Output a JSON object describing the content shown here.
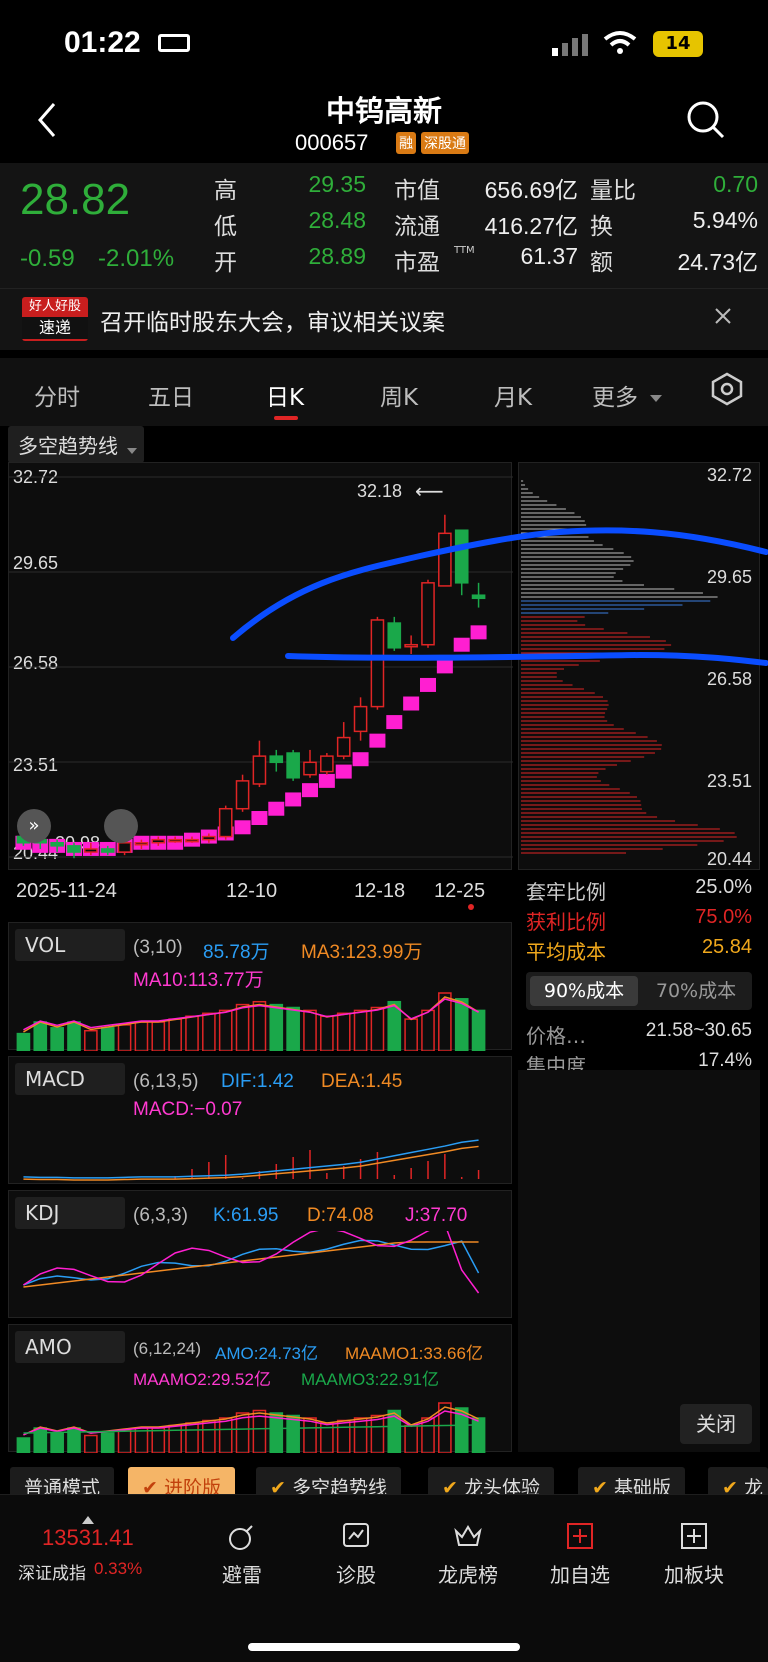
{
  "status": {
    "time": "01:22",
    "battery": "14"
  },
  "header": {
    "title": "中钨高新",
    "code": "000657",
    "badge_rong": "融",
    "badge_sgt": "深股通"
  },
  "quote": {
    "price": "28.82",
    "change": "-0.59",
    "change_pct": "-2.01%",
    "high_label": "高",
    "high": "29.35",
    "low_label": "低",
    "low": "28.48",
    "open_label": "开",
    "open": "28.89",
    "mcap_label": "市值",
    "mcap": "656.69亿",
    "float_label": "流通",
    "float": "416.27亿",
    "pe_label": "市盈",
    "pe_sup": "TTM",
    "pe": "61.37",
    "vr_label": "量比",
    "vr": "0.70",
    "turn_label": "换",
    "turn": "5.94%",
    "amt_label": "额",
    "amt": "24.73亿"
  },
  "news": {
    "logo_top": "好人好股",
    "logo_bottom": "速递",
    "text": "召开临时股东大会，审议相关议案"
  },
  "tabs": [
    "分时",
    "五日",
    "日K",
    "周K",
    "月K",
    "更多"
  ],
  "kline": {
    "indicator": "多空趋势线",
    "y_ticks": [
      "32.72",
      "29.65",
      "26.58",
      "23.51",
      "20.44"
    ],
    "max_label": "32.18",
    "min_label": "20.98",
    "x_ticks": [
      "2025-11-24",
      "12-10",
      "12-18",
      "12-25"
    ]
  },
  "right_panel": {
    "trapped_label": "套牢比例",
    "trapped": "25.0%",
    "profit_label": "获利比例",
    "profit": "75.0%",
    "avg_label": "平均成本",
    "avg": "25.84",
    "tab90": "90%成本",
    "tab70": "70%成本",
    "range_label": "价格…",
    "range": "21.58~30.65",
    "conc_label": "集中度",
    "conc": "17.4%",
    "close": "关闭"
  },
  "vol": {
    "name": "VOL",
    "params": "(3,10)",
    "v": "85.78万",
    "ma3": "MA3:123.99万",
    "ma10": "MA10:113.77万"
  },
  "macd": {
    "name": "MACD",
    "params": "(6,13,5)",
    "dif": "DIF:1.42",
    "dea": "DEA:1.45",
    "macd": "MACD:−0.07"
  },
  "kdj": {
    "name": "KDJ",
    "params": "(6,3,3)",
    "k": "K:61.95",
    "d": "D:74.08",
    "j": "J:37.70"
  },
  "amo": {
    "name": "AMO",
    "params": "(6,12,24)",
    "amo": "AMO:24.73亿",
    "m1": "MAAMO1:33.66亿",
    "m2": "MAAMO2:29.52亿",
    "m3": "MAAMO3:22.91亿"
  },
  "modes": [
    "普通模式",
    "进阶版",
    "多空趋势线",
    "龙头体验",
    "基础版",
    "龙"
  ],
  "bottom": {
    "index_value": "13531.41",
    "index_name": "深证成指",
    "index_pct": "0.33%",
    "items": [
      "避雷",
      "诊股",
      "龙虎榜",
      "加自选",
      "加板块"
    ]
  },
  "colors": {
    "up": "#e02525",
    "down": "#1aa84a",
    "accent": "#f08a24",
    "magenta": "#ff1fd1",
    "blue": "#2a9df4",
    "annotation": "#0a4dff"
  },
  "chart_data": {
    "type": "candlestick",
    "y_range": [
      20.44,
      32.72
    ],
    "candles": [
      [
        21.1,
        20.9,
        21.2,
        20.8
      ],
      [
        21.0,
        20.9,
        21.1,
        20.7
      ],
      [
        20.9,
        20.8,
        21.0,
        20.6
      ],
      [
        20.8,
        20.6,
        20.9,
        20.4
      ],
      [
        20.6,
        20.7,
        20.9,
        20.5
      ],
      [
        20.7,
        20.6,
        20.8,
        20.5
      ],
      [
        20.6,
        20.9,
        21.0,
        20.5
      ],
      [
        20.9,
        20.9,
        21.0,
        20.7
      ],
      [
        20.9,
        21.0,
        21.1,
        20.8
      ],
      [
        21.0,
        21.0,
        21.1,
        20.9
      ],
      [
        21.0,
        21.0,
        21.1,
        20.9
      ],
      [
        21.0,
        21.1,
        21.2,
        20.9
      ],
      [
        21.1,
        22.0,
        22.1,
        21.0
      ],
      [
        22.0,
        22.9,
        23.1,
        21.9
      ],
      [
        22.8,
        23.7,
        24.2,
        22.7
      ],
      [
        23.7,
        23.5,
        23.9,
        23.2
      ],
      [
        23.8,
        23.0,
        23.9,
        22.9
      ],
      [
        23.1,
        23.5,
        23.9,
        23.0
      ],
      [
        23.2,
        23.7,
        23.8,
        23.1
      ],
      [
        23.7,
        24.3,
        24.8,
        23.6
      ],
      [
        24.5,
        25.3,
        25.6,
        24.2
      ],
      [
        25.3,
        28.1,
        28.2,
        25.2
      ],
      [
        28.0,
        27.2,
        28.2,
        27.1
      ],
      [
        27.3,
        27.3,
        27.6,
        27.0
      ],
      [
        27.3,
        29.3,
        29.4,
        27.2
      ],
      [
        29.2,
        30.9,
        31.5,
        29.2
      ],
      [
        31.0,
        29.3,
        31.0,
        28.9
      ],
      [
        28.9,
        28.8,
        29.3,
        28.5
      ]
    ],
    "trend": [
      20.9,
      20.8,
      20.8,
      20.7,
      20.7,
      20.7,
      20.8,
      20.9,
      20.9,
      20.9,
      21.0,
      21.1,
      21.2,
      21.4,
      21.7,
      22.0,
      22.3,
      22.6,
      22.9,
      23.2,
      23.6,
      24.2,
      24.8,
      25.4,
      26.0,
      26.6,
      27.3,
      27.7
    ],
    "vol": [
      0.3,
      0.5,
      0.4,
      0.5,
      0.35,
      0.4,
      0.45,
      0.5,
      0.5,
      0.55,
      0.6,
      0.65,
      0.7,
      0.8,
      0.85,
      0.8,
      0.75,
      0.7,
      0.6,
      0.65,
      0.7,
      0.75,
      0.85,
      0.55,
      0.7,
      1.0,
      0.9,
      0.7
    ]
  }
}
